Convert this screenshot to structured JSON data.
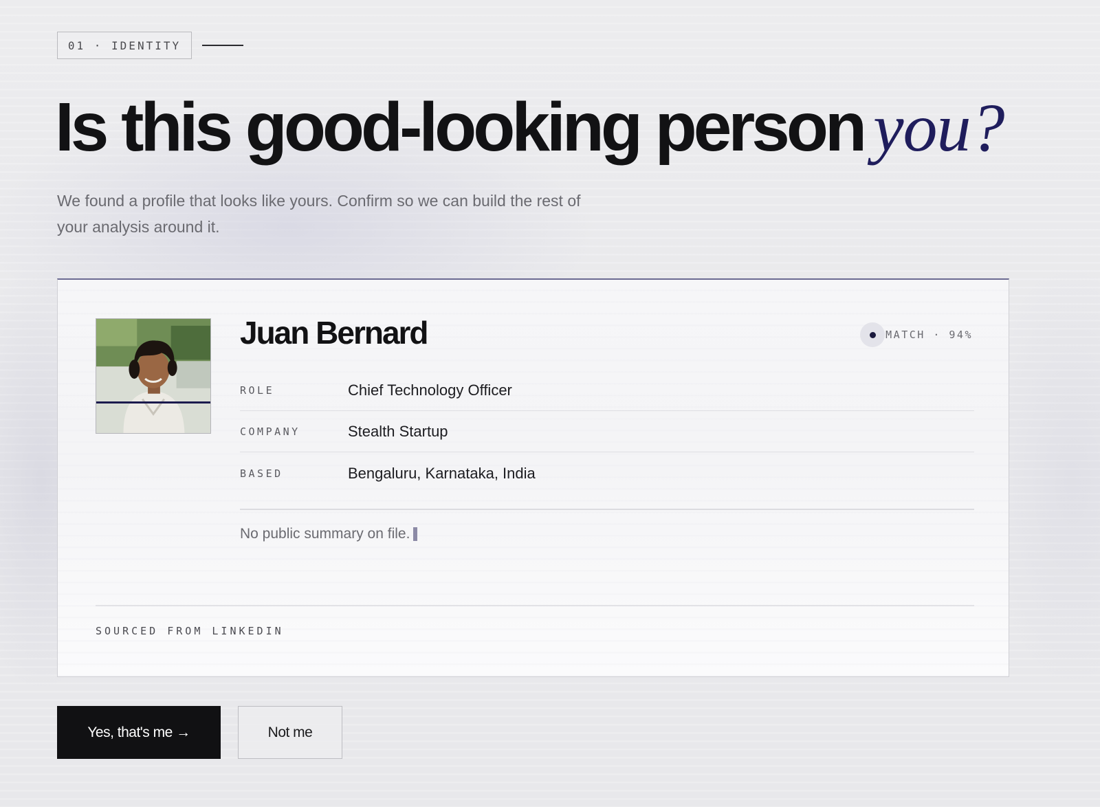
{
  "section": {
    "tag": "01 · IDENTITY"
  },
  "headline": {
    "main": "Is this good-looking person",
    "accent": "you?"
  },
  "subtitle": "We found a profile that looks like yours. Confirm so we can build the rest of your analysis around it.",
  "profile": {
    "name": "Juan Bernard",
    "match_label": "MATCH · 94%",
    "match_value": 0.94,
    "fields": [
      {
        "label": "ROLE",
        "value": "Chief Technology Officer"
      },
      {
        "label": "COMPANY",
        "value": "Stealth Startup"
      },
      {
        "label": "BASED",
        "value": "Bengaluru, Karnataka, India"
      }
    ],
    "summary": "No public summary on file.",
    "source": "SOURCED FROM LINKEDIN"
  },
  "actions": {
    "confirm_label": "Yes, that's me →",
    "reject_label": "Not me"
  },
  "colors": {
    "accent": "#1f1d5c",
    "primary_button": "#111113"
  }
}
